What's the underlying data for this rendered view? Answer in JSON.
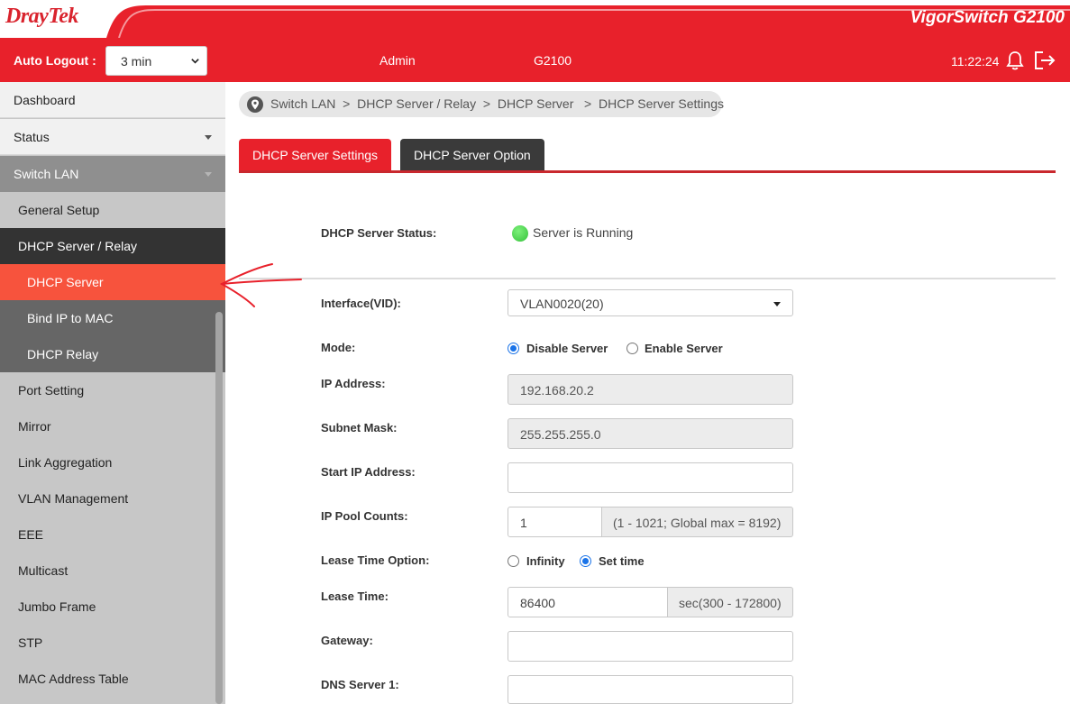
{
  "header": {
    "logo": "DrayTek",
    "product": "VigorSwitch G2100",
    "auto_logout_label": "Auto Logout :",
    "auto_logout_value": "3 min",
    "user": "Admin",
    "model": "G2100",
    "time": "11:22:24"
  },
  "sidebar": {
    "dashboard": "Dashboard",
    "status": "Status",
    "switch_lan": "Switch LAN",
    "general_setup": "General Setup",
    "dhcp_server_relay": "DHCP Server / Relay",
    "dhcp_server": "DHCP Server",
    "bind_ip_to_mac": "Bind IP to MAC",
    "dhcp_relay": "DHCP Relay",
    "port_setting": "Port Setting",
    "mirror": "Mirror",
    "link_aggregation": "Link Aggregation",
    "vlan_management": "VLAN Management",
    "eee": "EEE",
    "multicast": "Multicast",
    "jumbo_frame": "Jumbo Frame",
    "stp": "STP",
    "mac_address_table": "MAC Address Table"
  },
  "breadcrumb": "Switch LAN  >  DHCP Server / Relay  >  DHCP Server   >  DHCP Server Settings",
  "tabs": {
    "settings": "DHCP Server Settings",
    "option": "DHCP Server Option"
  },
  "form": {
    "status_label": "DHCP Server Status:",
    "status_value": "Server is Running",
    "interface_label": "Interface(VID):",
    "interface_value": "VLAN0020(20)",
    "mode_label": "Mode:",
    "mode_disable": "Disable Server",
    "mode_enable": "Enable Server",
    "ip_label": "IP Address:",
    "ip_value": "192.168.20.2",
    "mask_label": "Subnet Mask:",
    "mask_value": "255.255.255.0",
    "start_ip_label": "Start IP Address:",
    "start_ip_value": "",
    "pool_label": "IP Pool Counts:",
    "pool_value": "1",
    "pool_hint": "(1 - 1021; Global max = 8192)",
    "lease_option_label": "Lease Time Option:",
    "lease_infinity": "Infinity",
    "lease_set_time": "Set time",
    "lease_time_label": "Lease Time:",
    "lease_time_value": "86400",
    "lease_time_hint": "sec(300 - 172800)",
    "gateway_label": "Gateway:",
    "gateway_value": "",
    "dns1_label": "DNS Server 1:",
    "dns1_value": ""
  },
  "colors": {
    "brand_red": "#e8212b",
    "active_item": "#f7533d",
    "status_green": "#34c23a",
    "radio_blue": "#1a73e8"
  }
}
